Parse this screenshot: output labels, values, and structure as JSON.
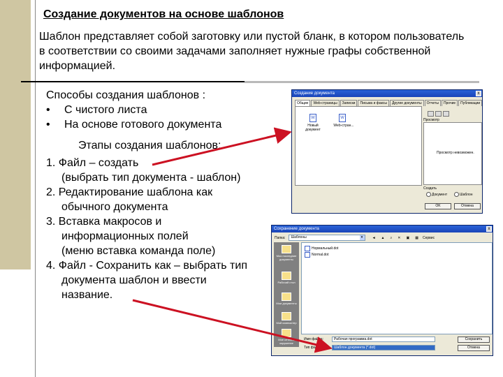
{
  "slide": {
    "title": "Создание документов на основе шаблонов",
    "intro": "Шаблон представляет собой заготовку или пустой бланк, в котором пользователь в соответствии со своими задачами заполняет нужные графы собственной информацией.",
    "ways_heading": "Способы создания шаблонов :",
    "ways": [
      {
        "bullet": "•",
        "text": "С чистого листа"
      },
      {
        "bullet": "•",
        "text": "На основе готового документа"
      }
    ],
    "stages_heading": "Этапы создания шаблонов:",
    "steps": [
      "1. Файл – создать",
      "(выбрать тип документа - шаблон)",
      "2. Редактирование шаблона как",
      "обычного документа",
      "3. Вставка макросов и",
      "информационных полей",
      "(меню вставка команда поле)",
      "4. Файл - Сохранить как – выбрать тип",
      "документа шаблон и ввести",
      "название."
    ]
  },
  "dialog_new": {
    "caption": "Создание документа",
    "close": "x",
    "tabs": [
      "Общие",
      "Web-страницы",
      "Записки",
      "Письма и факсы",
      "Другие документы",
      "Отчеты",
      "Прочие",
      "Публикации"
    ],
    "items": [
      {
        "label": "Новый документ",
        "glyph": "W"
      },
      {
        "label": "Web-стран...",
        "glyph": "W"
      }
    ],
    "preview_label": "Просмотр",
    "preview_text": "Просмотр невозможен.",
    "create_label": "Создать",
    "option_document": "Документ",
    "option_template": "Шаблон",
    "ok": "OK",
    "cancel": "Отмена"
  },
  "dialog_save": {
    "caption": "Сохранение документа",
    "folder_label": "Папка:",
    "folder": "Шаблоны",
    "tools": "Сервис",
    "places": [
      "Мои последние документы",
      "Рабочий стол",
      "Мои документы",
      "Мой компьютер",
      "Мое сетевое окружение"
    ],
    "files": [
      "Нормальный.dot",
      "Normal.dot"
    ],
    "filename_label": "Имя файла:",
    "filename": "Рабочая программа.dot",
    "filetype_label": "Тип файла:",
    "filetype": "Шаблон документа (*.dot)",
    "save": "Сохранить",
    "cancel": "Отмена"
  },
  "colors": {
    "sidebar": "#cfc6a2",
    "arrow": "#cc1122",
    "titlebar": "#2a63d8"
  }
}
